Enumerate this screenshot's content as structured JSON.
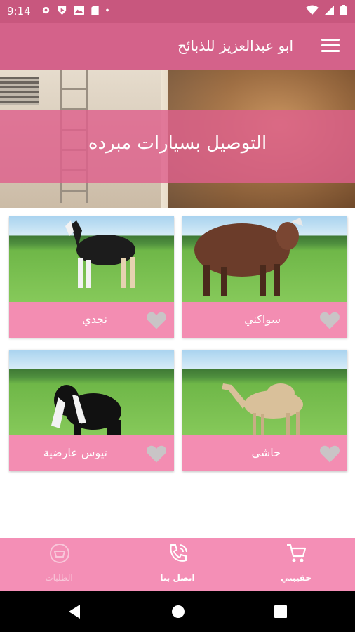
{
  "status_bar": {
    "time": "9:14"
  },
  "app_bar": {
    "title": "ابو عبدالعزيز للذبائح",
    "menu_icon": "hamburger-menu-icon"
  },
  "banner": {
    "caption": "التوصيل بسيارات مبرده",
    "slide_count": 3,
    "active_slide": 1
  },
  "products": [
    {
      "name": "سواكني",
      "favorite": false
    },
    {
      "name": "نجدي",
      "favorite": false
    },
    {
      "name": "حاشي",
      "favorite": false
    },
    {
      "name": "تيوس عارضية",
      "favorite": false
    }
  ],
  "bottom_nav": [
    {
      "label": "حقيبتي",
      "icon": "cart-icon"
    },
    {
      "label": "اتصل بنا",
      "icon": "phone-icon"
    },
    {
      "label": "الطلبات",
      "icon": "orders-icon"
    }
  ],
  "colors": {
    "status_bar": "#c8577e",
    "app_bar": "#d4628a",
    "accent": "#f38db2"
  }
}
